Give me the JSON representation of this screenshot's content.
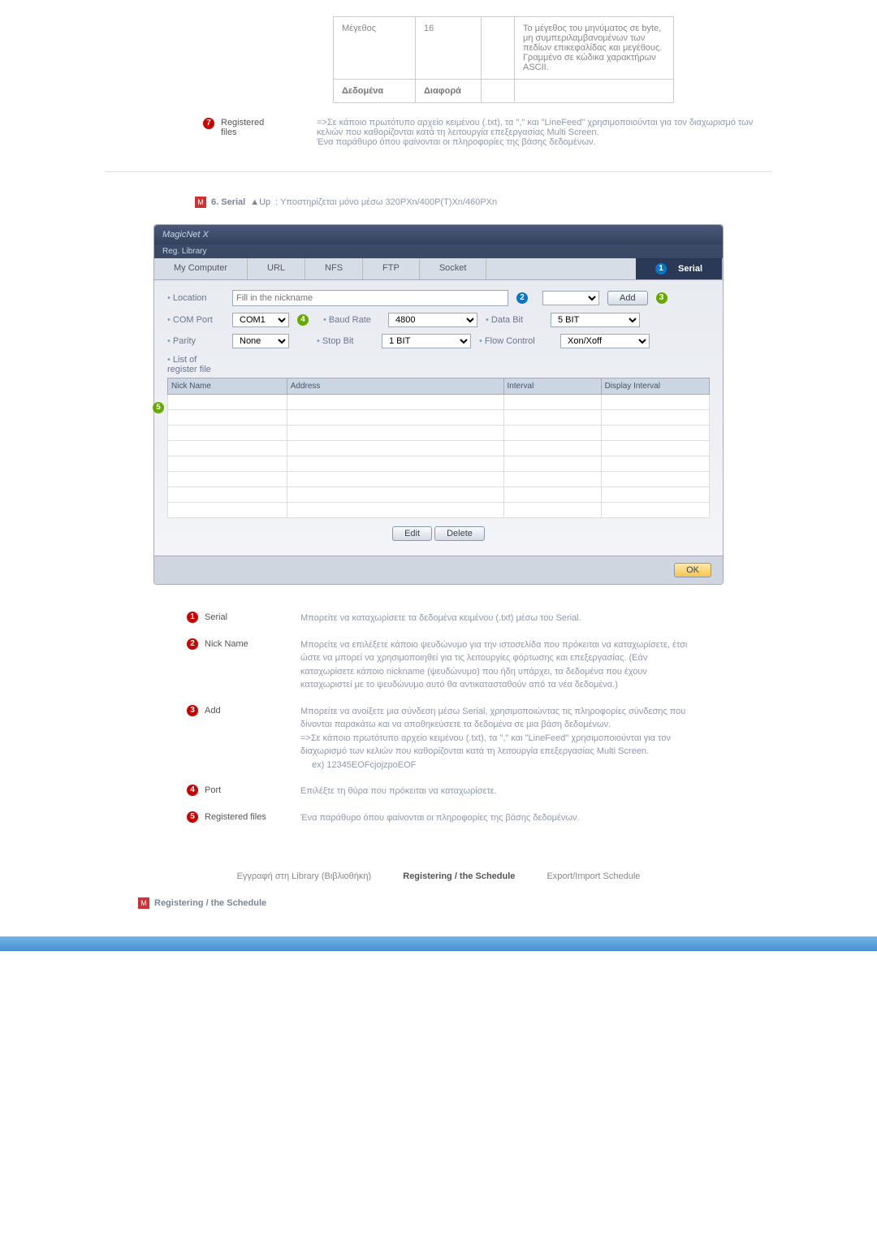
{
  "top_table": {
    "row1": {
      "c1": "Μέγεθος",
      "c2": "16",
      "c3": "",
      "c4": "Το μέγεθος του μηνύματος σε byte, μη συμπεριλαμβανομένων των πεδίων επικεφαλίδας και μεγέθους.\nΓραμμένο σε κώδικα χαρακτήρων ASCII."
    },
    "row2": {
      "c1": "Δεδομένα",
      "c2": "Διαφορά",
      "c3": "",
      "c4": ""
    }
  },
  "row7": {
    "label": "Registered files",
    "text": "=>Σε κάποιο πρωτότυπο αρχείο κειμένου (.txt), τα \",\" και \"LineFeed\" χρησιμοποιούνται για τον διαχωρισμό των κελιών που καθορίζονται κατά τη λειτουργία επεξεργασίας Multi Screen.\nΈνα παράθυρο όπου φαίνονται οι πληροφορίες της βάσης δεδομένων."
  },
  "section6": {
    "icon": "M",
    "title": "6. Serial",
    "up": "▲Up",
    "desc": ": Υποστηρίζεται μόνο μέσω 320PXn/400P(T)Xn/460PXn"
  },
  "panel": {
    "app": "MagicNet X",
    "sub": "Reg. Library",
    "tabs": {
      "t1": "My Computer",
      "t2": "URL",
      "t3": "NFS",
      "t4": "FTP",
      "t5": "Socket",
      "t6": "Serial"
    },
    "loc_lbl": "Location",
    "loc_ph": "Fill in the nickname",
    "add_btn": "Add",
    "com_lbl": "COM Port",
    "com_val": "COM1",
    "baud_lbl": "Baud Rate",
    "baud_val": "4800",
    "dbit_lbl": "Data Bit",
    "dbit_val": "5 BIT",
    "par_lbl": "Parity",
    "par_val": "None",
    "stop_lbl": "Stop Bit",
    "stop_val": "1 BIT",
    "flow_lbl": "Flow Control",
    "flow_val": "Xon/Xoff",
    "list_lbl": "List of register file",
    "th1": "Nick Name",
    "th2": "Address",
    "th3": "Interval",
    "th4": "Display Interval",
    "edit": "Edit",
    "del": "Delete",
    "ok": "OK"
  },
  "desc": {
    "r1": {
      "l": "Serial",
      "c": "Μπορείτε να καταχωρίσετε τα δεδομένα κειμένου (.txt) μέσω του Serial."
    },
    "r2": {
      "l": "Nick Name",
      "c": "Μπορείτε να επιλέξετε κάποιο ψευδώνυμο για την ιστοσελίδα που πρόκειται να καταχωρίσετε, έτσι ώστε να μπορεί να χρησιμοποιηθεί για τις λειτουργίες φόρτωσης και επεξεργασίας. (Εάν καταχωρίσετε κάποιο nickname (ψευδώνυμο) που ήδη υπάρχει, τα δεδομένα που έχουν καταχωριστεί με το ψευδώνυμο αυτό θα αντικατασταθούν από τα νέα δεδομένα.)"
    },
    "r3": {
      "l": "Add",
      "c": "Μπορείτε να ανοίξετε μια σύνδεση μέσω Serial, χρησιμοποιώντας τις πληροφορίες σύνδεσης που δίνονται παρακάτω και να αποθηκεύσετε τα δεδομένα σε μια βάση δεδομένων.\n=>Σε κάποιο πρωτότυπο αρχείο κειμένου (.txt), τα \",\" και \"LineFeed\" χρησιμοποιούνται για τον διαχωρισμό των κελιών που καθορίζονται κατά τη λειτουργία επεξεργασίας Multi Screen.",
      "ex": "ex) 12345EOFcjojzpoEOF"
    },
    "r4": {
      "l": "Port",
      "c": "Επιλέξτε τη θύρα που πρόκειται να καταχωρίσετε."
    },
    "r5": {
      "l": "Registered files",
      "c": "Ένα παράθυρο όπου φαίνονται οι πληροφορίες της βάσης δεδομένων."
    }
  },
  "links": {
    "l1": "Εγγραφή στη Library (Βιβλιοθήκη)",
    "l2": "Registering / the Schedule",
    "l3": "Export/Import Schedule"
  },
  "reg": {
    "icon": "M",
    "t": "Registering / the Schedule"
  }
}
